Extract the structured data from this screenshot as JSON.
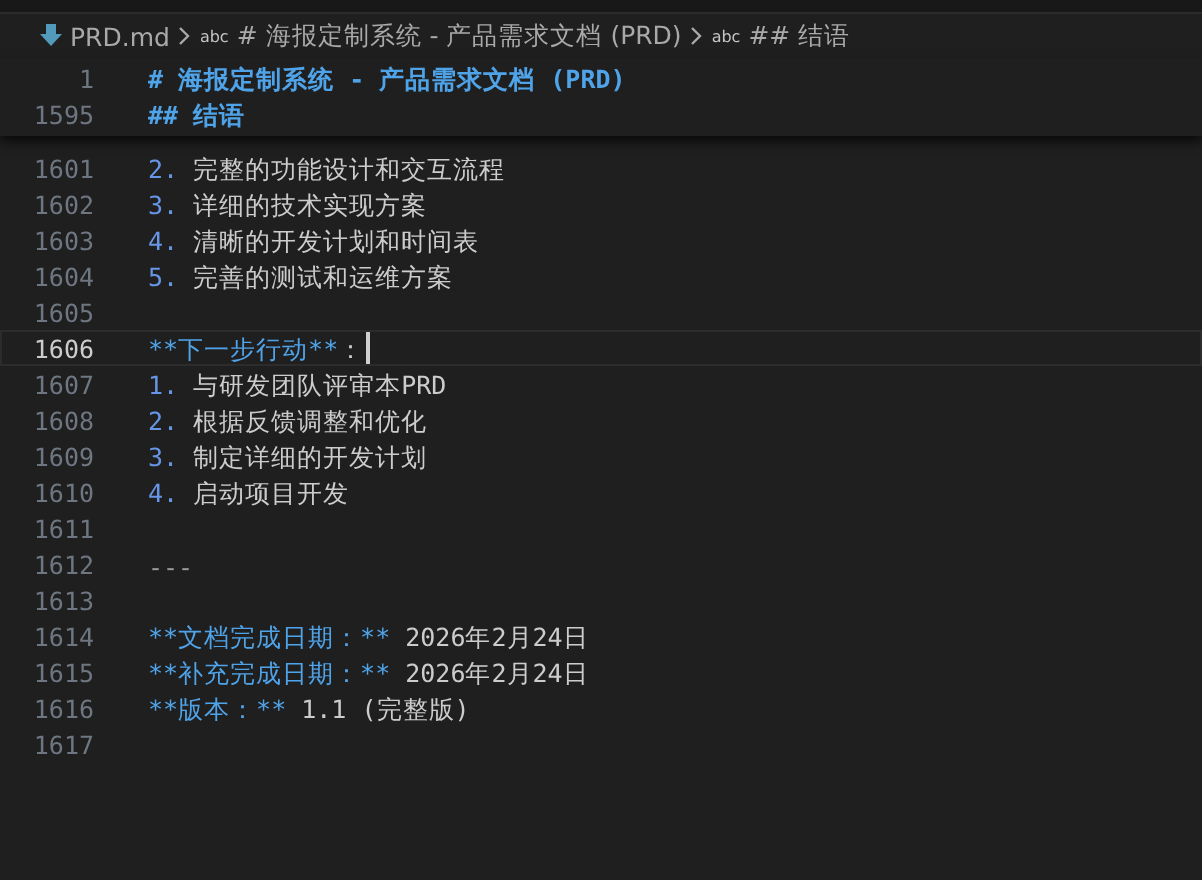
{
  "breadcrumbs": [
    {
      "kind": "file",
      "text": "PRD.md"
    },
    {
      "kind": "symbol",
      "icon_text": "abc",
      "text": "# 海报定制系统 - 产品需求文档 (PRD)"
    },
    {
      "kind": "symbol",
      "icon_text": "abc",
      "text": "## 结语"
    }
  ],
  "sticky_lines": [
    {
      "number": "1",
      "tokens": [
        {
          "kind": "heading",
          "text": "# 海报定制系统 - 产品需求文档 (PRD)"
        }
      ]
    },
    {
      "number": "1595",
      "tokens": [
        {
          "kind": "heading",
          "text": "## 结语"
        }
      ]
    }
  ],
  "lines": [
    {
      "number": "1601",
      "current": false,
      "tokens": [
        {
          "kind": "marker",
          "text": "2."
        },
        {
          "kind": "plain",
          "text": " 完整的功能设计和交互流程"
        }
      ]
    },
    {
      "number": "1602",
      "current": false,
      "tokens": [
        {
          "kind": "marker",
          "text": "3."
        },
        {
          "kind": "plain",
          "text": " 详细的技术实现方案"
        }
      ]
    },
    {
      "number": "1603",
      "current": false,
      "tokens": [
        {
          "kind": "marker",
          "text": "4."
        },
        {
          "kind": "plain",
          "text": " 清晰的开发计划和时间表"
        }
      ]
    },
    {
      "number": "1604",
      "current": false,
      "tokens": [
        {
          "kind": "marker",
          "text": "5."
        },
        {
          "kind": "plain",
          "text": " 完善的测试和运维方案"
        }
      ]
    },
    {
      "number": "1605",
      "current": false
    },
    {
      "number": "1606",
      "current": true,
      "tokens": [
        {
          "kind": "bold",
          "text": "**下一步行动**"
        },
        {
          "kind": "plain",
          "text": "："
        }
      ]
    },
    {
      "number": "1607",
      "current": false,
      "tokens": [
        {
          "kind": "marker",
          "text": "1."
        },
        {
          "kind": "plain",
          "text": " 与研发团队评审本PRD"
        }
      ]
    },
    {
      "number": "1608",
      "current": false,
      "tokens": [
        {
          "kind": "marker",
          "text": "2."
        },
        {
          "kind": "plain",
          "text": " 根据反馈调整和优化"
        }
      ]
    },
    {
      "number": "1609",
      "current": false,
      "tokens": [
        {
          "kind": "marker",
          "text": "3."
        },
        {
          "kind": "plain",
          "text": " 制定详细的开发计划"
        }
      ]
    },
    {
      "number": "1610",
      "current": false,
      "tokens": [
        {
          "kind": "marker",
          "text": "4."
        },
        {
          "kind": "plain",
          "text": " 启动项目开发"
        }
      ]
    },
    {
      "number": "1611",
      "current": false
    },
    {
      "number": "1612",
      "current": false,
      "tokens": [
        {
          "kind": "rule",
          "text": "---"
        }
      ]
    },
    {
      "number": "1613",
      "current": false
    },
    {
      "number": "1614",
      "current": false,
      "tokens": [
        {
          "kind": "bold",
          "text": "**文档完成日期：**"
        },
        {
          "kind": "plain",
          "text": " 2026年2月24日"
        }
      ]
    },
    {
      "number": "1615",
      "current": false,
      "tokens": [
        {
          "kind": "bold",
          "text": "**补充完成日期：**"
        },
        {
          "kind": "plain",
          "text": " 2026年2月24日"
        }
      ]
    },
    {
      "number": "1616",
      "current": false,
      "tokens": [
        {
          "kind": "bold",
          "text": "**版本：**"
        },
        {
          "kind": "plain",
          "text": " 1.1 (完整版)"
        }
      ]
    },
    {
      "number": "1617",
      "current": false
    }
  ]
}
